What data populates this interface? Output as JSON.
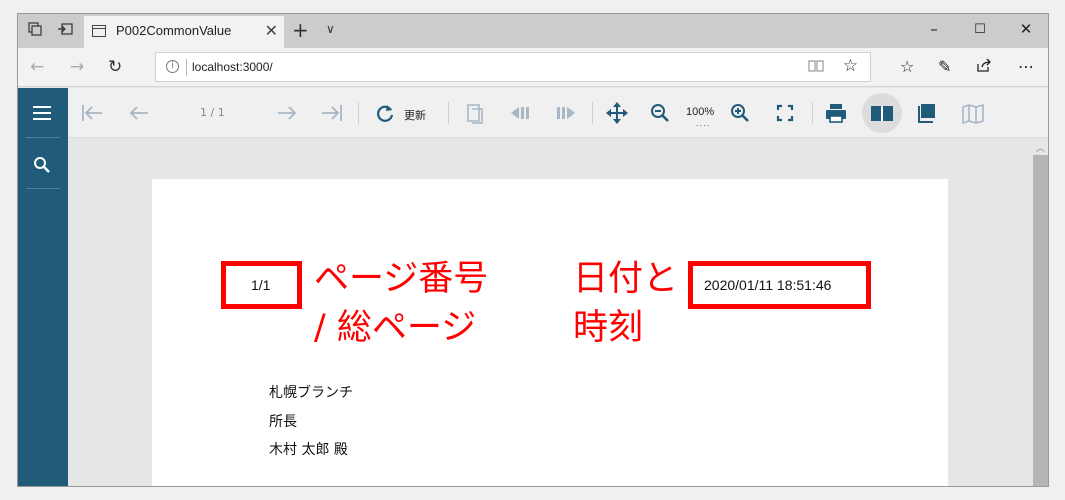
{
  "browser": {
    "tab_title": "P002CommonValue",
    "new_tab": "+",
    "tab_menu": "∨",
    "url": "localhost:3000/",
    "min": "–",
    "max": "☐",
    "close": "✕"
  },
  "toolbar": {
    "page_indicator": "1 / 1",
    "refresh_label": "更新",
    "zoom_label": "100%",
    "zoom_dots": "...."
  },
  "report": {
    "page_number": "1/1",
    "datetime": "2020/01/11 18:51:46",
    "address_lines": [
      "札幌ブランチ",
      "所長",
      "木村 太郎 殿"
    ]
  },
  "annotations": {
    "page_label_line1": "ページ番号",
    "page_label_line2": "/ 総ページ",
    "date_label_line1": "日付と",
    "date_label_line2": "時刻"
  },
  "colors": {
    "annotation": "#ff0000",
    "sidebar": "#205c7a"
  }
}
